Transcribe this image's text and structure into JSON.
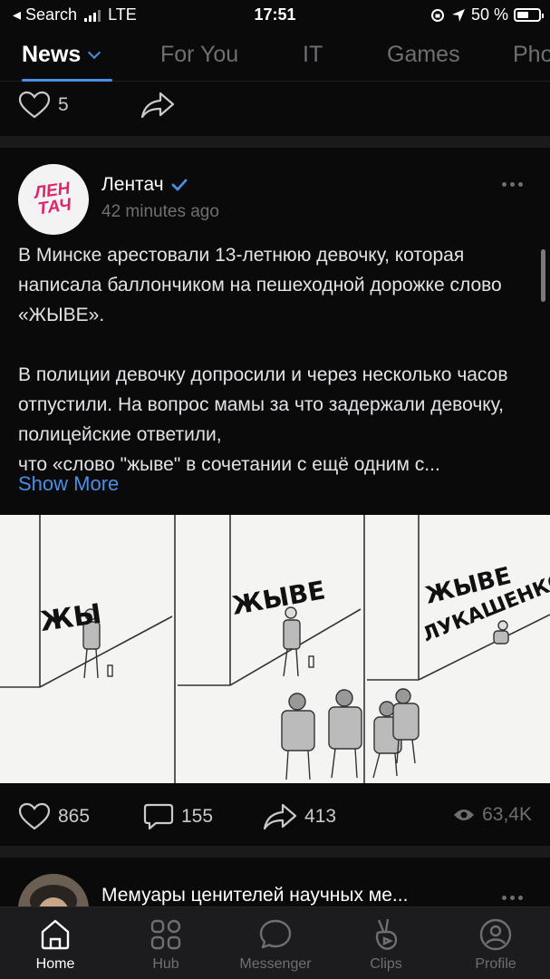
{
  "status_bar": {
    "carrier": "◂ Search",
    "network": "LTE",
    "time": "17:51",
    "battery": "50 %"
  },
  "tabs": [
    {
      "label": "News",
      "active": true
    },
    {
      "label": "For You"
    },
    {
      "label": "IT"
    },
    {
      "label": "Games"
    },
    {
      "label": "Pho"
    }
  ],
  "prev_post": {
    "likes": "5"
  },
  "post": {
    "author": "Лентач",
    "avatar_text": "ЛЕН ТАЧ",
    "time": "42 minutes ago",
    "paragraph1": "В Минске арестовали 13-летнюю девочку, которая написала баллончиком на пешеходной дорожке слово «ЖЫВЕ».",
    "paragraph2": "В полиции девочку допросили и через несколько часов отпустили. На вопрос мамы за что задержали девочку, полицейские ответили,",
    "paragraph2_last": "что «слово \"жыве\" в сочетании с ещё одним с...",
    "show_more": "Show More",
    "comic_captions": [
      "ЖЫ",
      "ЖЫВЕ",
      "ЖЫВЕ",
      "ЛУКАШЕНКО"
    ],
    "likes": "865",
    "comments": "155",
    "shares": "413",
    "views": "63,4K"
  },
  "next_post": {
    "title": "Мемуары ценителей научных ме..."
  },
  "bottom_nav": [
    {
      "label": "Home",
      "icon": "home-icon",
      "active": true
    },
    {
      "label": "Hub",
      "icon": "grid-icon"
    },
    {
      "label": "Messenger",
      "icon": "chat-icon"
    },
    {
      "label": "Clips",
      "icon": "clips-icon"
    },
    {
      "label": "Profile",
      "icon": "profile-icon"
    }
  ],
  "colors": {
    "accent": "#4a8fe7",
    "background": "#0a0a0a",
    "separator": "#1a1a1b"
  }
}
